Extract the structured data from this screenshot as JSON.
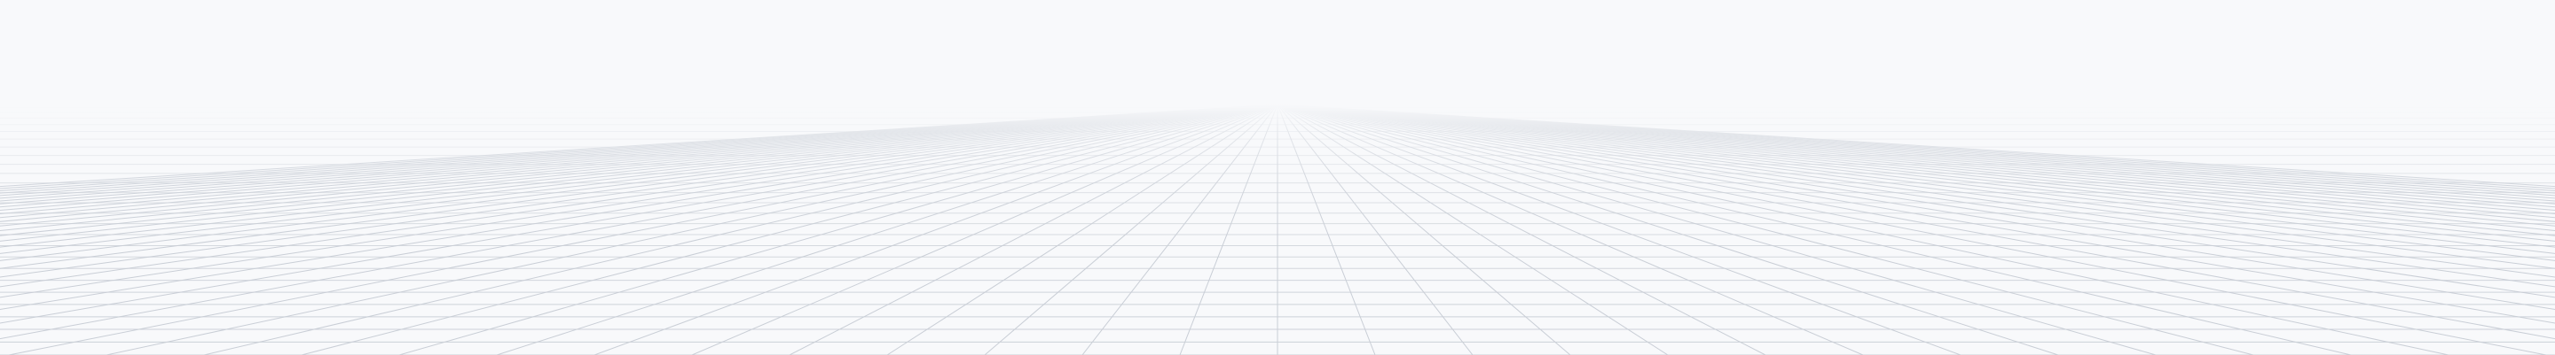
{
  "scene": {
    "description_free": true,
    "background_color": "#f8f9fb",
    "grid_line_color": "#c9ced6",
    "icon": "perspective-grid"
  }
}
